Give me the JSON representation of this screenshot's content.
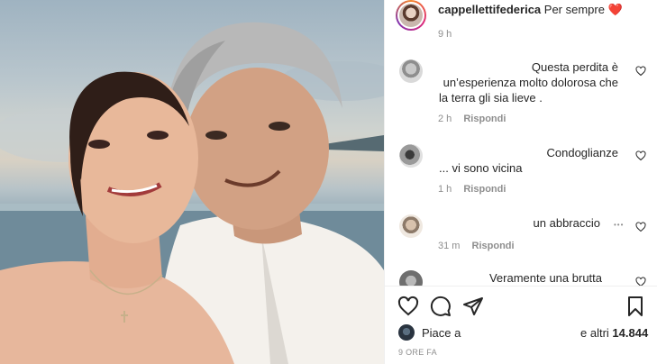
{
  "post": {
    "author": "cappellettifederica",
    "caption": "Per sempre",
    "caption_emoji": "❤️",
    "time": "9 h"
  },
  "comments": [
    {
      "lines": [
        "Questa perdita è",
        "un’esperienza molto dolorosa che",
        "la terra gli sia lieve ."
      ],
      "age": "2 h",
      "reply": "Rispondi"
    },
    {
      "lines": [
        "Condoglianze",
        "... vi sono vicina"
      ],
      "age": "1 h",
      "reply": "Rispondi"
    },
    {
      "lines": [
        "un abbraccio"
      ],
      "age": "31 m",
      "reply": "Rispondi",
      "more": "•••"
    },
    {
      "lines": [
        "Veramente una brutta"
      ]
    }
  ],
  "actions": {
    "like_icon": "heart-outline-icon",
    "comment_icon": "comment-bubble-icon",
    "share_icon": "paper-plane-icon",
    "save_icon": "bookmark-icon"
  },
  "likes": {
    "prefix": "Piace a",
    "suffix": "e altri",
    "count": "14.844"
  },
  "post_age": "9 ORE FA",
  "colors": {
    "text": "#262626",
    "muted": "#8e8e8e",
    "divider": "#efefef",
    "heart": "#e0245e"
  }
}
